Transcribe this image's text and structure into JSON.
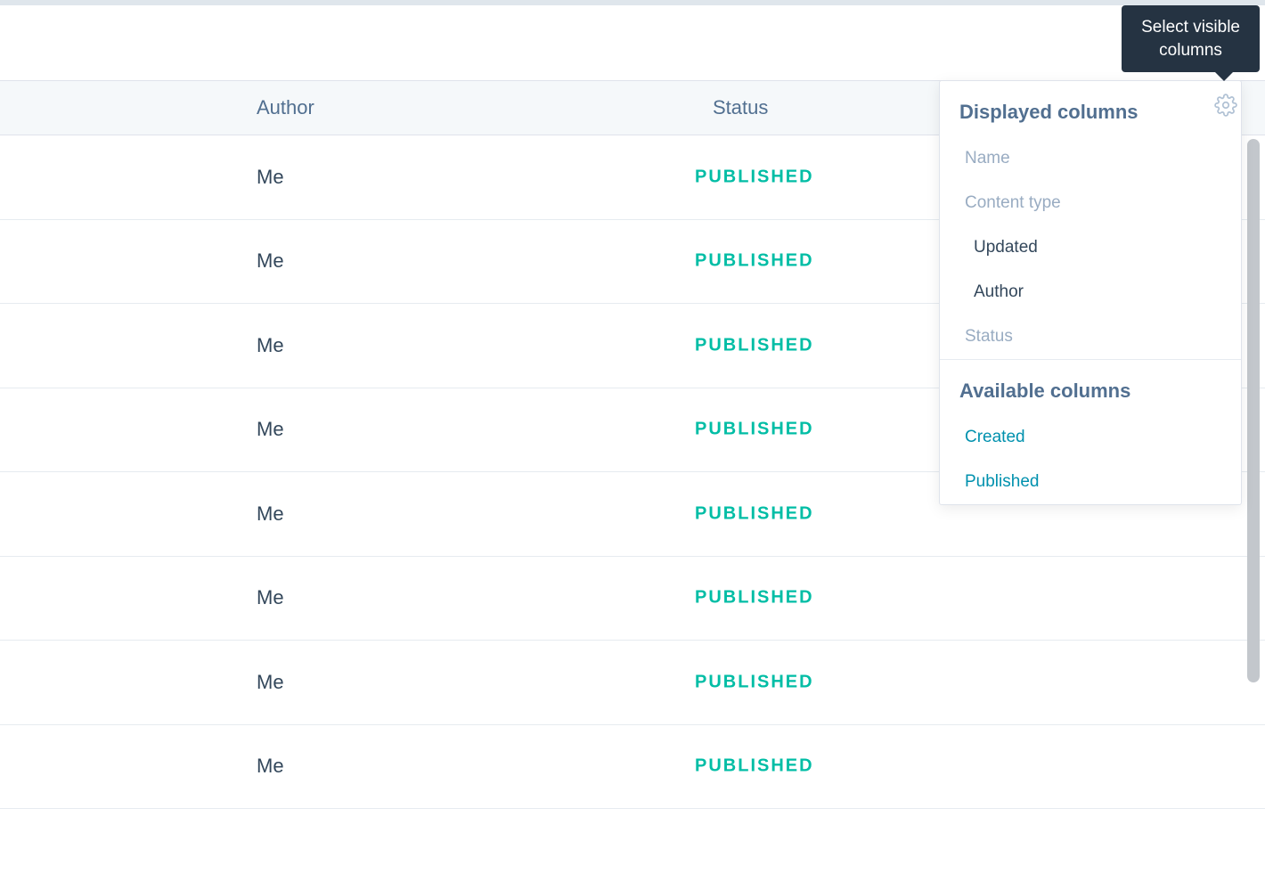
{
  "tooltip": {
    "line1": "Select visible",
    "line2": "columns"
  },
  "table": {
    "columns": {
      "author": "Author",
      "status": "Status"
    },
    "rows": [
      {
        "author": "Me",
        "status": "PUBLISHED"
      },
      {
        "author": "Me",
        "status": "PUBLISHED"
      },
      {
        "author": "Me",
        "status": "PUBLISHED"
      },
      {
        "author": "Me",
        "status": "PUBLISHED"
      },
      {
        "author": "Me",
        "status": "PUBLISHED"
      },
      {
        "author": "Me",
        "status": "PUBLISHED"
      },
      {
        "author": "Me",
        "status": "PUBLISHED"
      },
      {
        "author": "Me",
        "status": "PUBLISHED"
      }
    ]
  },
  "popover": {
    "displayed_title": "Displayed columns",
    "displayed": [
      {
        "label": "Name",
        "locked": true
      },
      {
        "label": "Content type",
        "locked": true
      },
      {
        "label": "Updated",
        "locked": false
      },
      {
        "label": "Author",
        "locked": false
      },
      {
        "label": "Status",
        "locked": true
      }
    ],
    "available_title": "Available columns",
    "available": [
      {
        "label": "Created"
      },
      {
        "label": "Published"
      }
    ]
  }
}
